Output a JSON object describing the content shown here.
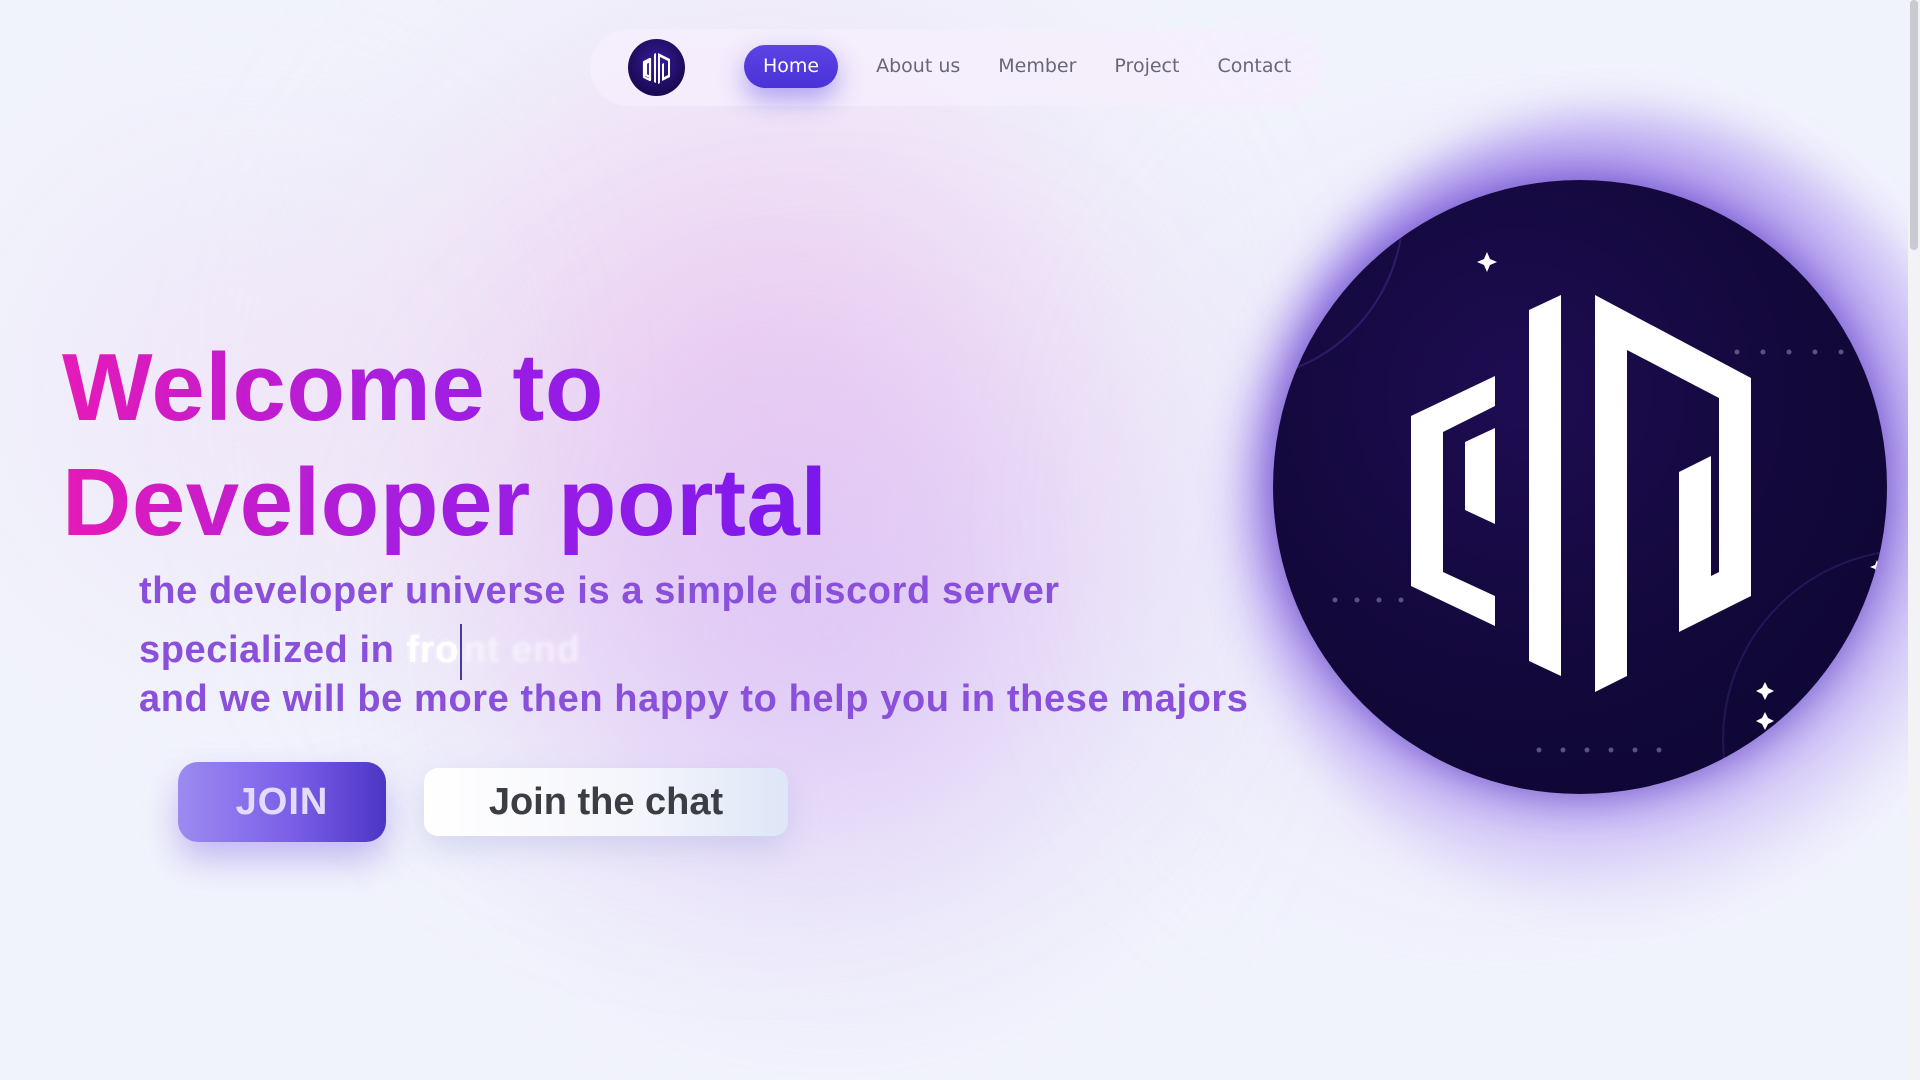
{
  "nav": {
    "logo_icon": "developer-portal-logo-icon",
    "items": [
      {
        "label": "Home",
        "active": true
      },
      {
        "label": "About us",
        "active": false
      },
      {
        "label": "Member",
        "active": false
      },
      {
        "label": "Project",
        "active": false
      },
      {
        "label": "Contact",
        "active": false
      }
    ]
  },
  "hero": {
    "title_line_1": "Welcome to",
    "title_line_2": "Developer portal",
    "subtitle_line_1": "the developer universe is a simple discord server",
    "subtitle_line_2_prefix": "specialized in",
    "typed_visible": "fro",
    "typed_faded": "nt end",
    "subtitle_line_3": "and we will be more then happy to help you in these majors"
  },
  "buttons": {
    "join_label": "JOIN",
    "chat_label": "Join the chat"
  },
  "colors": {
    "accent": "#5b43e6",
    "title_gradient_start": "#e61ab8",
    "title_gradient_end": "#7a18ee",
    "subtitle": "#8a50dc",
    "logo_background": "#12083a"
  }
}
